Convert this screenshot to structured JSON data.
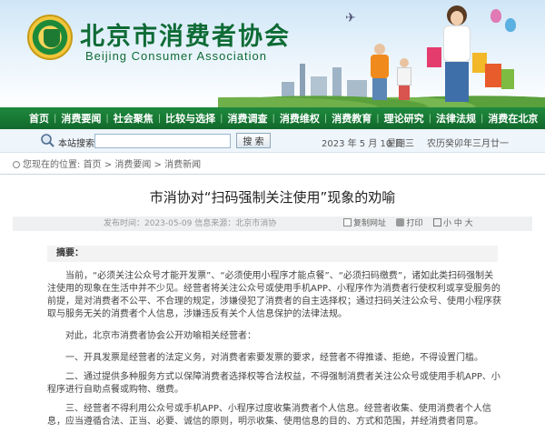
{
  "site": {
    "name_cn": "北京市消费者协会",
    "name_en": "Beijing Consumer Association"
  },
  "nav": {
    "items": [
      "首页",
      "消费要闻",
      "社会聚焦",
      "比较与选择",
      "消费调查",
      "消费维权",
      "消费教育",
      "理论研究",
      "法律法规",
      "消费在北京"
    ]
  },
  "search": {
    "label": "本站搜索:",
    "value": "",
    "button": "搜 索"
  },
  "date": {
    "gregorian": "2023 年 5 月 10 日",
    "weekday": "星期三",
    "lunar": "农历癸卯年三月廿一"
  },
  "breadcrumb": {
    "prefix": "您现在的位置:",
    "home": "首页",
    "sep1": ">",
    "section": "消费要闻",
    "sep2": ">",
    "current": "消费新闻"
  },
  "article": {
    "title": "市消协对“扫码强制关注使用”现象的劝喻",
    "published": "发布时间：2023-05-09",
    "source": "信息来源：北京市消协",
    "copy_link": "复制网址",
    "print": "打印",
    "font_size_label": "小 中 大",
    "abstract_label": "摘要：",
    "paragraphs": [
      "当前，“必须关注公众号才能开发票”、“必须使用小程序才能点餐”、“必须扫码缴费”，诸如此类扫码强制关注使用的现象在生活中并不少见。经营者将关注公众号或使用手机APP、小程序作为消费者行使权利或享受服务的前提，是对消费者不公平、不合理的规定，涉嫌侵犯了消费者的自主选择权；通过扫码关注公众号、使用小程序获取与服务无关的消费者个人信息，涉嫌违反有关个人信息保护的法律法规。",
      "对此，北京市消费者协会公开劝喻相关经营者：",
      "一、开具发票是经营者的法定义务，对消费者索要发票的要求，经营者不得推诿、拒绝，不得设置门槛。",
      "二、通过提供多种服务方式以保障消费者选择权等合法权益，不得强制消费者关注公众号或使用手机APP、小程序进行自助点餐或购物、缴费。",
      "三、经营者不得利用公众号或手机APP、小程序过度收集消费者个人信息。经营者收集、使用消费者个人信息，应当遵循合法、正当、必要、诚信的原则，明示收集、使用信息的目的、方式和范围，并经消费者同意。"
    ]
  },
  "colors": {
    "nav_bg": "#1a7d37",
    "brand_green": "#0e6b35",
    "banner_sky": "#cfe6f7"
  }
}
